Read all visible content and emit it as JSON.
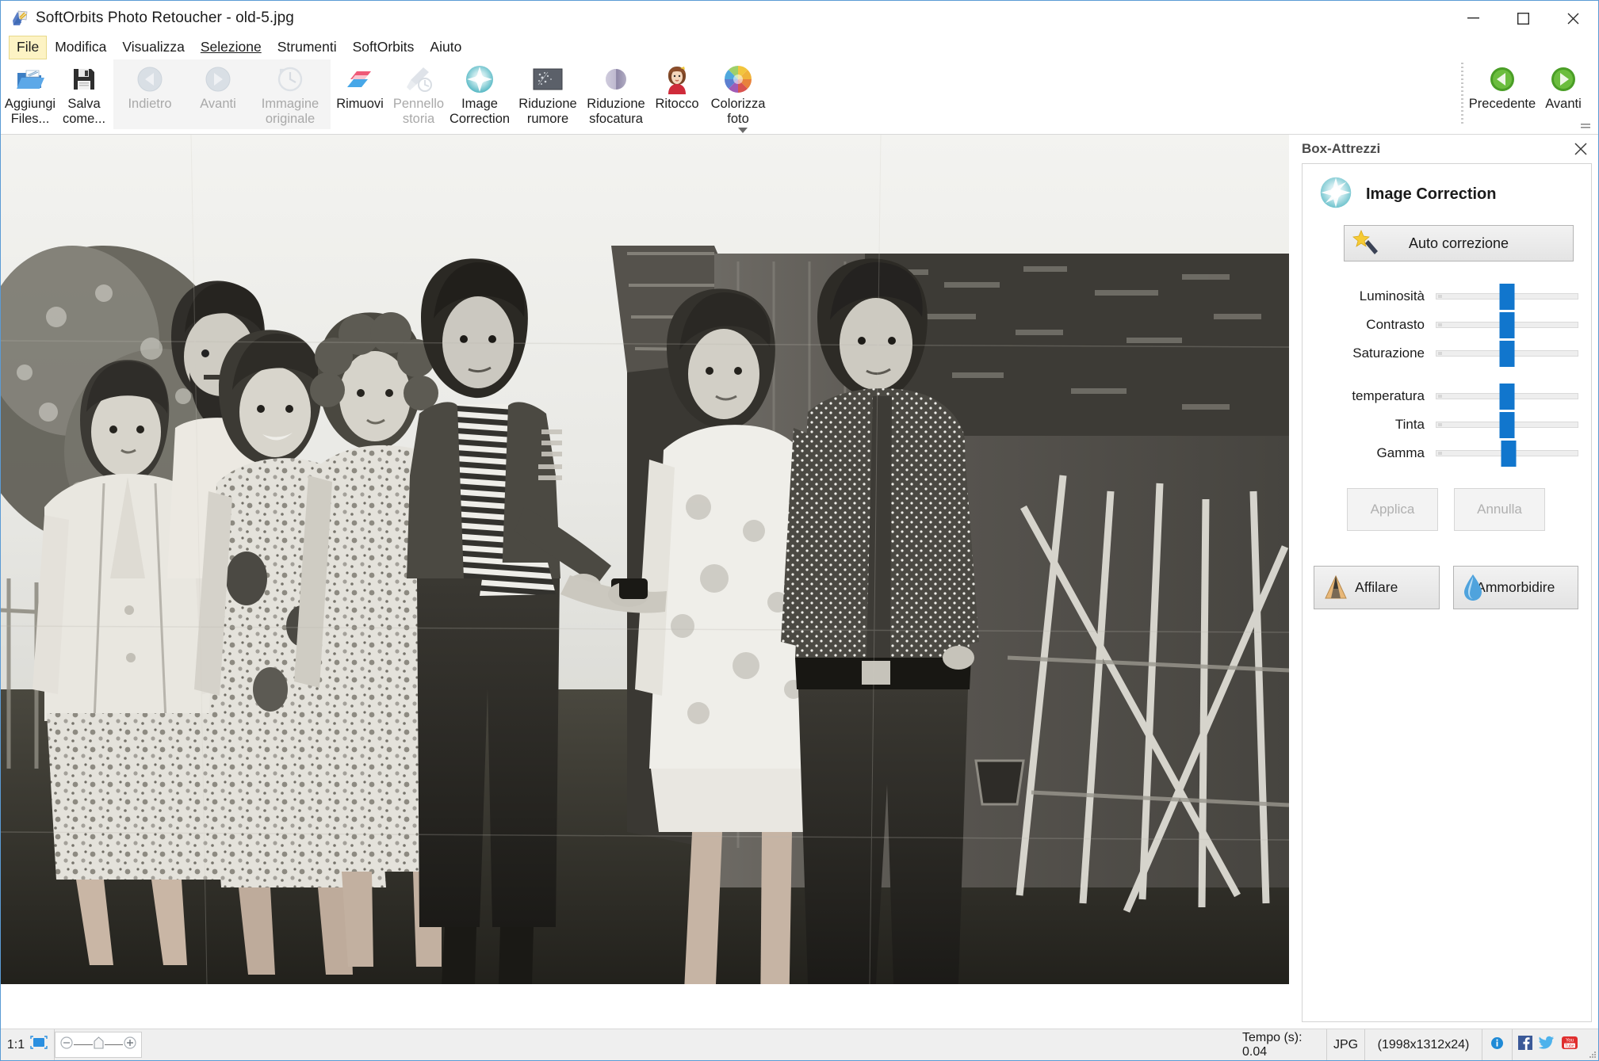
{
  "window": {
    "title": "SoftOrbits Photo Retoucher - old-5.jpg",
    "app_icon": "app-logo-icon",
    "minimize": "—",
    "maximize": "□",
    "close": "✕"
  },
  "menubar": {
    "items": [
      {
        "label": "File",
        "active": true
      },
      {
        "label": "Modifica",
        "active": false
      },
      {
        "label": "Visualizza",
        "active": false
      },
      {
        "label": "Selezione",
        "active": false,
        "accel": "S"
      },
      {
        "label": "Strumenti",
        "active": false
      },
      {
        "label": "SoftOrbits",
        "active": false
      },
      {
        "label": "Aiuto",
        "active": false
      }
    ]
  },
  "ribbon": {
    "groups": [
      {
        "disabled": false,
        "tools": [
          {
            "label": "Aggiungi Files...",
            "icon": "add-files-icon",
            "disabled": false
          },
          {
            "label": "Salva come...",
            "icon": "save-as-icon",
            "disabled": false
          }
        ]
      },
      {
        "disabled": true,
        "tools": [
          {
            "label": "Indietro",
            "icon": "undo-arrow-icon",
            "disabled": true
          },
          {
            "label": "Avanti",
            "icon": "redo-arrow-icon",
            "disabled": true
          },
          {
            "label": "Immagine originale",
            "icon": "original-image-clock-icon",
            "disabled": true
          }
        ]
      },
      {
        "disabled": false,
        "tools": [
          {
            "label": "Rimuovi",
            "icon": "remove-brush-icon",
            "disabled": false
          }
        ]
      },
      {
        "disabled": false,
        "tools": [
          {
            "label": "Pennello storia",
            "icon": "history-brush-icon",
            "disabled": true
          },
          {
            "label": "Image Correction",
            "icon": "image-correction-icon",
            "disabled": false
          },
          {
            "label": "Riduzione rumore",
            "icon": "noise-reduction-icon",
            "disabled": false
          },
          {
            "label": "Riduzione sfocatura",
            "icon": "blur-reduction-icon",
            "disabled": false
          },
          {
            "label": "Ritocco",
            "icon": "retouch-portrait-icon",
            "disabled": false
          },
          {
            "label": "Colorizza foto",
            "icon": "colorize-photo-icon",
            "disabled": false
          }
        ]
      }
    ],
    "right_tools": [
      {
        "label": "Precedente",
        "icon": "previous-green-arrow-icon"
      },
      {
        "label": "Avanti",
        "icon": "next-green-arrow-icon"
      }
    ],
    "expand_icon": "ribbon-expand-icon"
  },
  "toolbox": {
    "header_title": "Box-Attrezzi",
    "close_icon": "panel-close-icon",
    "module_icon": "image-correction-icon",
    "module_name": "Image Correction",
    "auto_button": {
      "label": "Auto correzione",
      "icon": "magic-wand-icon"
    },
    "sliders": [
      {
        "label": "Luminosità",
        "value": 50
      },
      {
        "label": "Contrasto",
        "value": 50
      },
      {
        "label": "Saturazione",
        "value": 50
      },
      {
        "label": "temperatura",
        "value": 50
      },
      {
        "label": "Tinta",
        "value": 50
      },
      {
        "label": "Gamma",
        "value": 51
      }
    ],
    "apply_button": "Applica",
    "cancel_button": "Annulla",
    "sharpen_button": {
      "label": "Affilare",
      "icon": "sharpen-triangle-icon"
    },
    "soften_button": {
      "label": "Ammorbidire",
      "icon": "soften-drop-icon"
    }
  },
  "statusbar": {
    "zoom_ratio": "1:1",
    "fit_icon": "fit-to-window-icon",
    "zoom_out_icon": "zoom-out-icon",
    "zoom_in_icon": "zoom-in-icon",
    "zoom_handle_icon": "zoom-slider-handle-icon",
    "time_label": "Tempo (s): 0.04",
    "format": "JPG",
    "dimensions": "(1998x1312x24)",
    "info_icon": "info-icon",
    "facebook_icon": "facebook-icon",
    "twitter_icon": "twitter-icon",
    "youtube_icon": "youtube-icon",
    "resize_grip_icon": "resize-grip-icon"
  },
  "canvas": {
    "image_name": "old-5.jpg",
    "alt": "vintage black and white group photograph of seven people standing in front of a wooden shed"
  },
  "colors": {
    "accent": "#1176cd",
    "window_border": "#5b9bd5",
    "menu_highlight": "#fdf3c4",
    "status_bg": "#efefef"
  }
}
